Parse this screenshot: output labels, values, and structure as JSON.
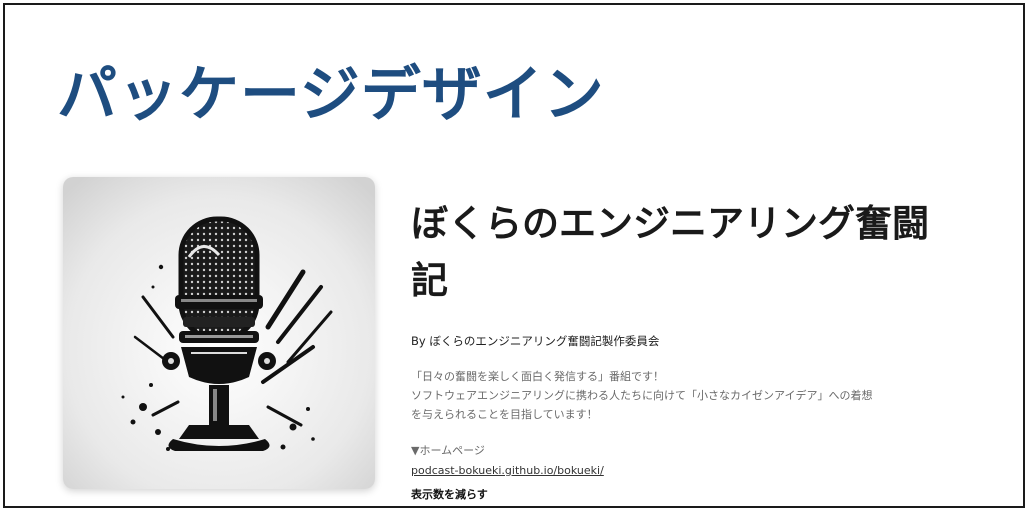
{
  "slide": {
    "title": "パッケージデザイン"
  },
  "podcast": {
    "title": "ぼくらのエンジニアリング奮闘記",
    "author": "By ぼくらのエンジニアリング奮闘記製作委員会",
    "description": [
      "「日々の奮闘を楽しく面白く発信する」番組です！",
      "ソフトウェアエンジニアリングに携わる人たちに向けて「小さなカイゼンアイデア」への着想",
      "を与えられることを目指しています！"
    ],
    "homepage_label": "▼ホームページ",
    "homepage_url": "podcast-bokueki.github.io/bokueki/",
    "show_less": "表示数を減らす",
    "cover_icon": "microphone-icon"
  },
  "colors": {
    "title": "#1e4d80",
    "text": "#1a1a1a",
    "muted": "#6a6a6a"
  }
}
